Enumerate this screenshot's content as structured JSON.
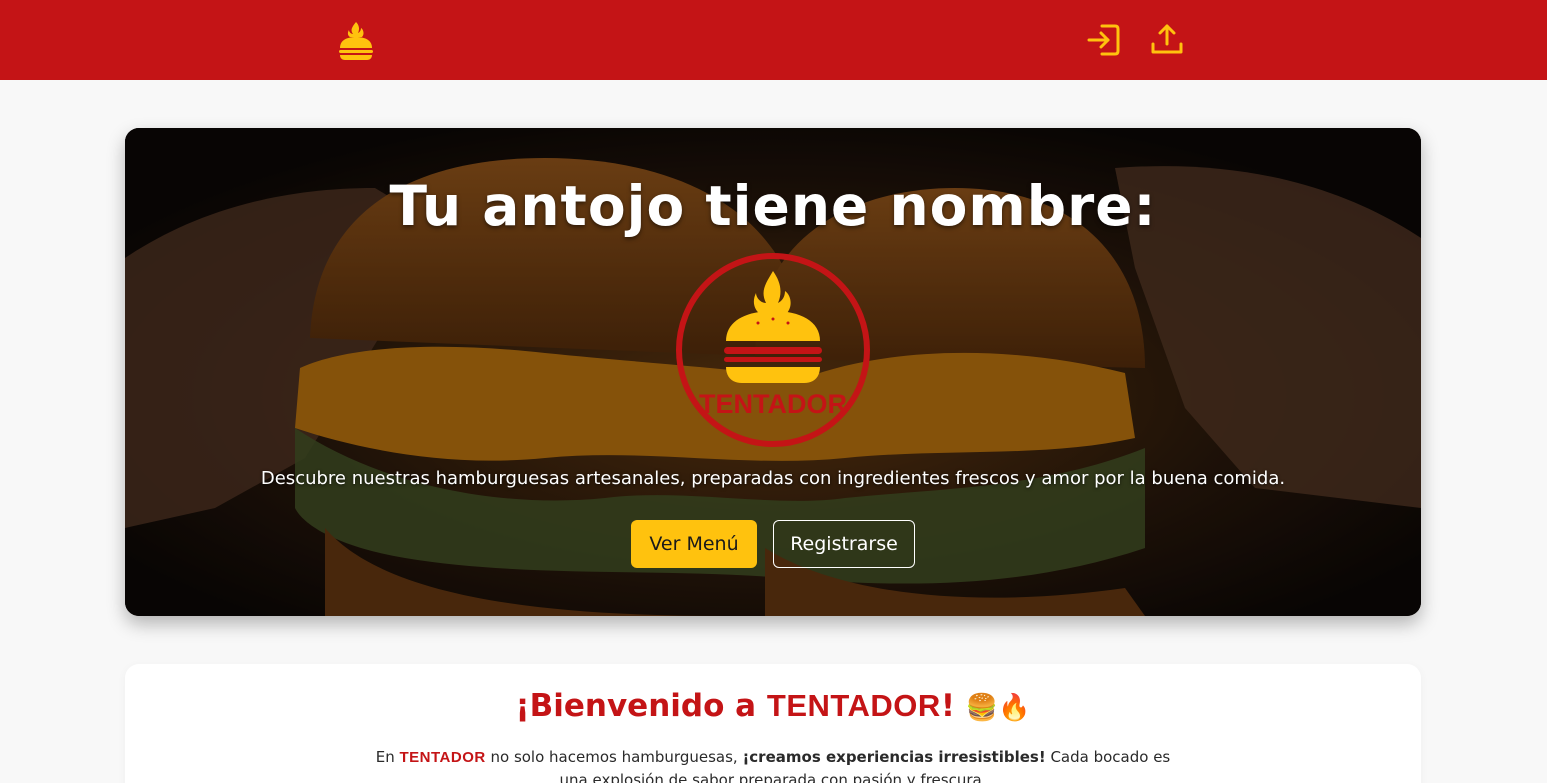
{
  "nav": {
    "logo_icon": "burger-flame-icon",
    "login_icon": "login-icon",
    "register_icon": "upload-icon"
  },
  "hero": {
    "title": "Tu antojo tiene nombre:",
    "logo_text": "TENTADOR",
    "description": "Descubre nuestras hamburguesas artesanales, preparadas con ingredientes frescos y amor por la buena comida.",
    "menu_button": "Ver Menú",
    "register_button": "Registrarse"
  },
  "welcome": {
    "title_prefix": "¡Bienvenido a ",
    "title_brand": "TENTADOR",
    "title_suffix": "!",
    "title_emojis": "🍔🔥",
    "text_en": "En ",
    "text_brand": "TENTADOR",
    "text_mid": " no solo hacemos hamburguesas, ",
    "text_bold": "¡creamos experiencias irresistibles!",
    "text_end": " Cada bocado es una explosión de sabor preparada con pasión y frescura."
  },
  "colors": {
    "brand_red": "#c41416",
    "accent_yellow": "#ffc20e",
    "background": "#f8f8f8"
  }
}
